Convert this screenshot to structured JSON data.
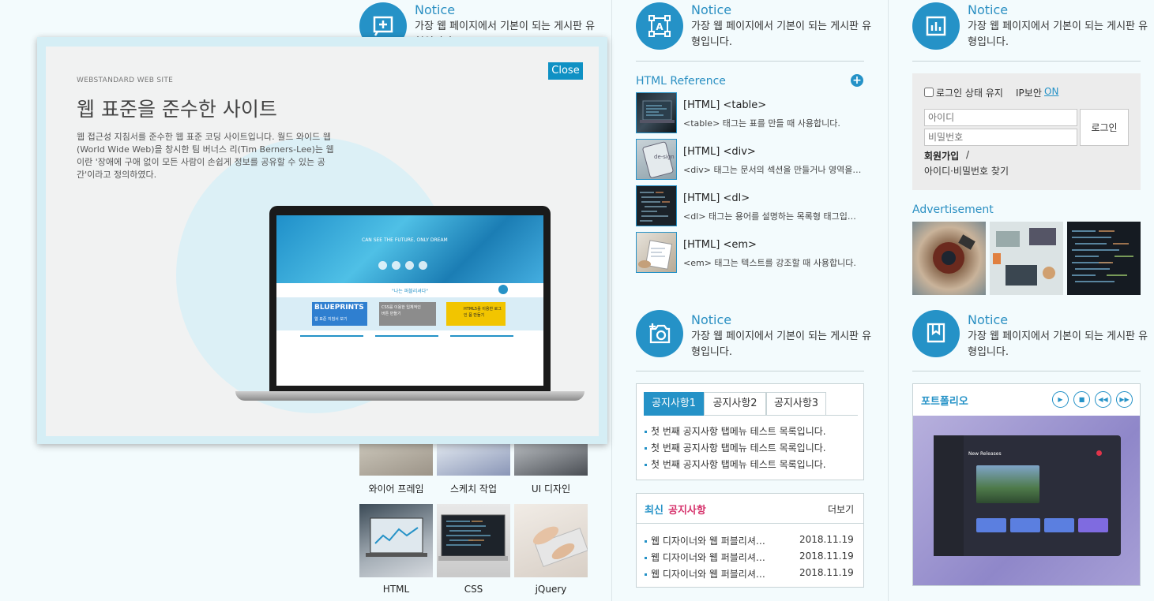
{
  "notices": [
    {
      "title": "Notice",
      "desc": "가장 웹 페이지에서 기본이 되는 게시판 유형입니다.",
      "icon": "add-square-icon"
    },
    {
      "title": "Notice",
      "desc": "가장 웹 페이지에서 기본이 되는 게시판 유형입니다.",
      "icon": "text-frame-icon"
    },
    {
      "title": "Notice",
      "desc": "가장 웹 페이지에서 기본이 되는 게시판 유형입니다.",
      "icon": "bar-chart-icon"
    },
    {
      "title": "Notice",
      "desc": "가장 웹 페이지에서 기본이 되는 게시판 유형입니다.",
      "icon": "camera-add-icon"
    },
    {
      "title": "Notice",
      "desc": "가장 웹 페이지에서 기본이 되는 게시판 유형입니다.",
      "icon": "book-icon"
    }
  ],
  "html_reference": {
    "title": "HTML Reference",
    "items": [
      {
        "title": "[HTML] <table>",
        "desc": "<table> 태그는 표를 만들 때 사용합니다."
      },
      {
        "title": "[HTML] <div>",
        "desc": "<div> 태그는 문서의 섹션을 만들거나 영역을 지정할 때 사용합니다."
      },
      {
        "title": "[HTML] <dl>",
        "desc": "<dl> 태그는 용어를 설명하는 목록형 태그입니다."
      },
      {
        "title": "[HTML] <em>",
        "desc": "<em> 태그는 텍스트를 강조할 때 사용합니다."
      }
    ]
  },
  "login": {
    "keep_label": "로그인 상태 유지",
    "ip_label": "IP보안",
    "ip_value": "ON",
    "id_placeholder": "아이디",
    "pw_placeholder": "비밀번호",
    "login_button": "로그인",
    "join": "회원가입",
    "separator": "/",
    "find": "아이디·비밀번호 찾기"
  },
  "advertisement": {
    "title": "Advertisement"
  },
  "gallery": [
    {
      "label": "와이어 프레임"
    },
    {
      "label": "스케치 작업"
    },
    {
      "label": "UI 디자인"
    },
    {
      "label": "HTML"
    },
    {
      "label": "CSS"
    },
    {
      "label": "jQuery"
    }
  ],
  "tabs": {
    "labels": [
      "공지사항1",
      "공지사항2",
      "공지사항3"
    ],
    "items": [
      "첫 번째 공지사항 탭메뉴 테스트 목록입니다.",
      "첫 번째 공지사항 탭메뉴 테스트 목록입니다.",
      "첫 번째 공지사항 탭메뉴 테스트 목록입니다."
    ]
  },
  "latest": {
    "title_a": "최신",
    "title_b": "공지사항",
    "more": "더보기",
    "items": [
      {
        "text": "웹 디자이너와 웹 퍼블리셔의 차이",
        "date": "2018.11.19"
      },
      {
        "text": "웹 디자이너와 웹 퍼블리셔의 차이",
        "date": "2018.11.19"
      },
      {
        "text": "웹 디자이너와 웹 퍼블리셔의 차이",
        "date": "2018.11.19"
      }
    ]
  },
  "portfolio": {
    "title": "포트폴리오",
    "controls": [
      "play-icon",
      "stop-icon",
      "prev-icon",
      "next-icon"
    ],
    "app_heading": "New Releases"
  },
  "popup": {
    "close": "Close",
    "eyebrow": "WEBSTANDARD WEB SITE",
    "heading": "웹 표준을 준수한 사이트",
    "body": "웹 접근성 지침서를 준수한 웹 표준 코딩 사이트입니다. 월드 와이드 웹 (World Wide Web)을 창시한 팀 버너스 리(Tim Berners-Lee)는 웹이란 '장애에 구애 없이 모든 사람이 손쉽게 정보를 공유할 수 있는 공간'이라고 정의하였다.",
    "screen_hero": "CAN SEE THE FUTURE, ONLY DREAM",
    "screen_tag": "\"나는 퍼블리셔다\"",
    "screen_banner1": "BLUEPRINTS",
    "screen_banner1_sub": "웹 표준 지침서 보기",
    "screen_banner2": "CSS를 이용한 입체적인 버튼 만들기",
    "screen_banner3": "HTML5를 이용한 로그인 폼 만들기"
  },
  "colors": {
    "accent": "#2592c7",
    "background": "#f3fbfd",
    "pink": "#d6336c"
  }
}
